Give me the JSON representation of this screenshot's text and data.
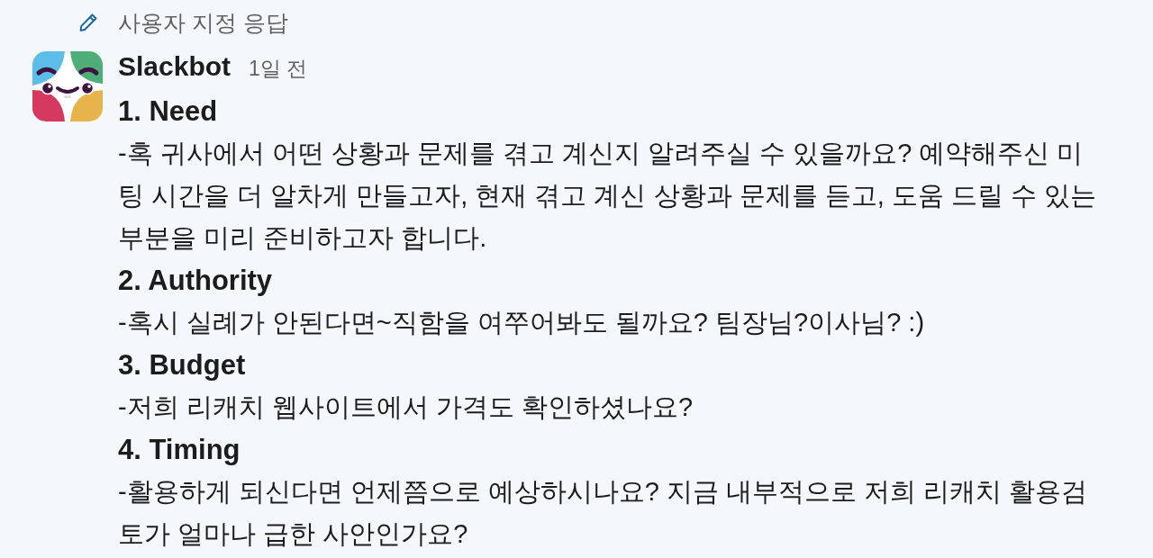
{
  "header": {
    "label": "사용자 지정 응답"
  },
  "message": {
    "sender": "Slackbot",
    "time": "1일 전",
    "sections": [
      {
        "heading": "1. Need",
        "body": "-혹 귀사에서 어떤 상황과 문제를 겪고 계신지 알려주실 수 있을까요? 예약해주신 미팅 시간을 더 알차게 만들고자, 현재 겪고 계신 상황과 문제를 듣고, 도움 드릴 수 있는 부분을 미리 준비하고자 합니다."
      },
      {
        "heading": "2. Authority",
        "body": "-혹시 실례가 안된다면~직함을 여쭈어봐도 될까요? 팀장님?이사님? :)"
      },
      {
        "heading": "3. Budget",
        "body": "-저희 리캐치 웹사이트에서 가격도 확인하셨나요?"
      },
      {
        "heading": "4. Timing",
        "body": "-활용하게 되신다면 언제쯤으로 예상하시나요? 지금 내부적으로 저희 리캐치 활용검토가 얼마나 급한 사안인가요?"
      }
    ]
  }
}
